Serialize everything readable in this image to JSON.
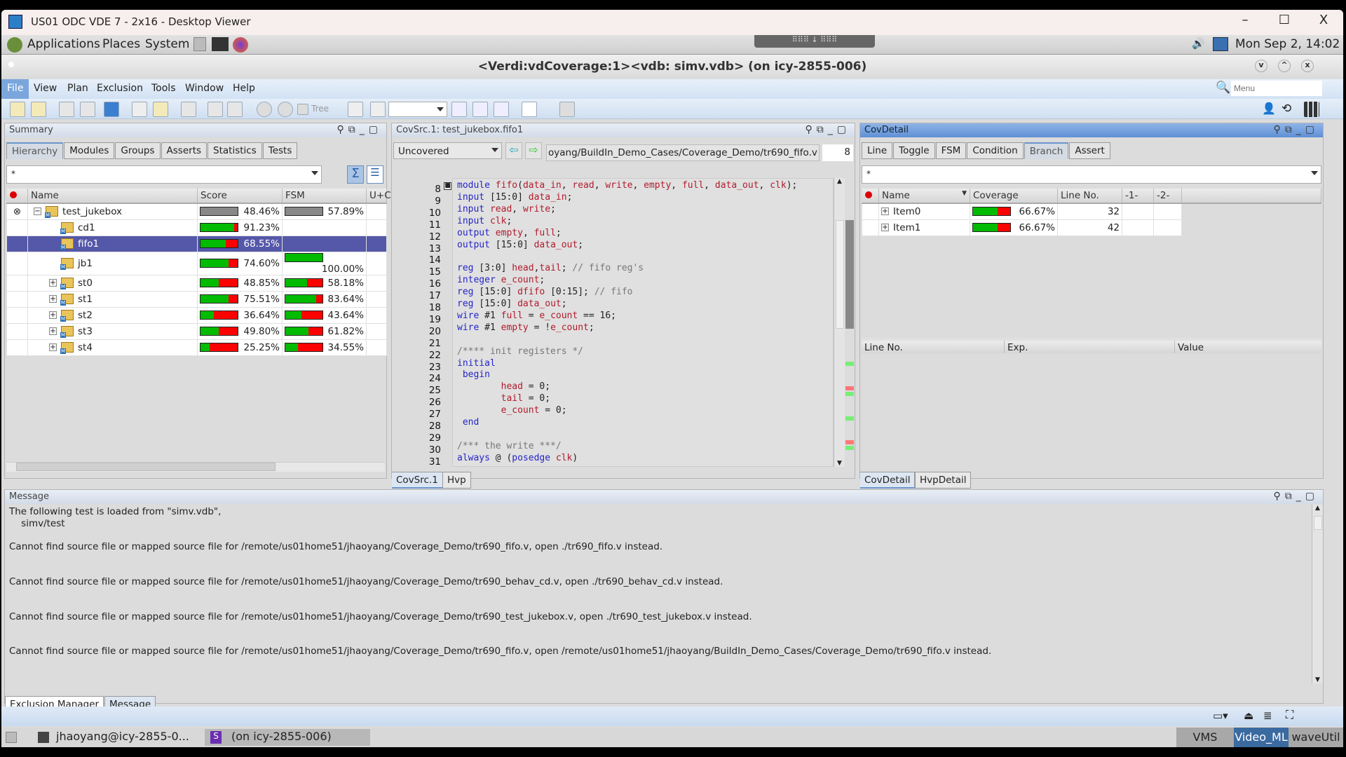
{
  "viewer": {
    "title": "US01 ODC VDE 7 - 2x16 - Desktop Viewer",
    "minimize": "–",
    "maximize": "☐",
    "close": "X"
  },
  "gnome": {
    "applications": "Applications",
    "places": "Places",
    "system": "System",
    "clock": "Mon Sep  2, 14:02"
  },
  "app": {
    "title": "<Verdi:vdCoverage:1><vdb: simv.vdb> (on icy-2855-006)"
  },
  "menu": {
    "items": [
      "File",
      "View",
      "Plan",
      "Exclusion",
      "Tools",
      "Window",
      "Help"
    ],
    "search_placeholder": "Menu",
    "tree_label": "Tree"
  },
  "summary": {
    "title": "Summary",
    "tabs": [
      "Hierarchy",
      "Modules",
      "Groups",
      "Asserts",
      "Statistics",
      "Tests"
    ],
    "filter": "*",
    "columns": [
      "Name",
      "Score",
      "FSM",
      "U+C"
    ],
    "rows": [
      {
        "name": "test_jukebox",
        "score": "48.46%",
        "fsm": "57.89%",
        "level": 0,
        "expander": "−",
        "gray": true
      },
      {
        "name": "cd1",
        "score": "91.23%",
        "fsm": "",
        "level": 1,
        "expander": ""
      },
      {
        "name": "fifo1",
        "score": "68.55%",
        "fsm": "",
        "level": 1,
        "expander": "",
        "selected": true
      },
      {
        "name": "jb1",
        "score": "74.60%",
        "fsm": "100.00%",
        "level": 1,
        "expander": ""
      },
      {
        "name": "st0",
        "score": "48.85%",
        "fsm": "58.18%",
        "level": 1,
        "expander": "+"
      },
      {
        "name": "st1",
        "score": "75.51%",
        "fsm": "83.64%",
        "level": 1,
        "expander": "+"
      },
      {
        "name": "st2",
        "score": "36.64%",
        "fsm": "43.64%",
        "level": 1,
        "expander": "+"
      },
      {
        "name": "st3",
        "score": "49.80%",
        "fsm": "61.82%",
        "level": 1,
        "expander": "+"
      },
      {
        "name": "st4",
        "score": "25.25%",
        "fsm": "34.55%",
        "level": 1,
        "expander": "+"
      }
    ]
  },
  "covsrc": {
    "title": "CovSrc.1: test_jukebox.fifo1",
    "mode": "Uncovered",
    "path": "oyang/BuildIn_Demo_Cases/Coverage_Demo/tr690_fifo.v",
    "line_input": "8",
    "first_line": 8,
    "lines": [
      [
        [
          "kw",
          "module"
        ],
        [
          "pn",
          " "
        ],
        [
          "id",
          "fifo"
        ],
        [
          "pn",
          "("
        ],
        [
          "id",
          "data_in"
        ],
        [
          "pn",
          ", "
        ],
        [
          "id",
          "read"
        ],
        [
          "pn",
          ", "
        ],
        [
          "id",
          "write"
        ],
        [
          "pn",
          ", "
        ],
        [
          "id",
          "empty"
        ],
        [
          "pn",
          ", "
        ],
        [
          "id",
          "full"
        ],
        [
          "pn",
          ", "
        ],
        [
          "id",
          "data_out"
        ],
        [
          "pn",
          ", "
        ],
        [
          "id",
          "clk"
        ],
        [
          "pn",
          ");"
        ]
      ],
      [
        [
          "kw",
          "input"
        ],
        [
          "pn",
          " [15:0] "
        ],
        [
          "id",
          "data_in"
        ],
        [
          "pn",
          ";"
        ]
      ],
      [
        [
          "kw",
          "input"
        ],
        [
          "pn",
          " "
        ],
        [
          "id",
          "read"
        ],
        [
          "pn",
          ", "
        ],
        [
          "id",
          "write"
        ],
        [
          "pn",
          ";"
        ]
      ],
      [
        [
          "kw",
          "input"
        ],
        [
          "pn",
          " "
        ],
        [
          "id",
          "clk"
        ],
        [
          "pn",
          ";"
        ]
      ],
      [
        [
          "kw",
          "output"
        ],
        [
          "pn",
          " "
        ],
        [
          "id",
          "empty"
        ],
        [
          "pn",
          ", "
        ],
        [
          "id",
          "full"
        ],
        [
          "pn",
          ";"
        ]
      ],
      [
        [
          "kw",
          "output"
        ],
        [
          "pn",
          " [15:0] "
        ],
        [
          "id",
          "data_out"
        ],
        [
          "pn",
          ";"
        ]
      ],
      [],
      [
        [
          "kw",
          "reg"
        ],
        [
          "pn",
          " [3:0] "
        ],
        [
          "id",
          "head"
        ],
        [
          "pn",
          ","
        ],
        [
          "id",
          "tail"
        ],
        [
          "pn",
          "; "
        ],
        [
          "cm",
          "// fifo reg's"
        ]
      ],
      [
        [
          "kw",
          "integer"
        ],
        [
          "pn",
          " "
        ],
        [
          "id",
          "e_count"
        ],
        [
          "pn",
          ";"
        ]
      ],
      [
        [
          "kw",
          "reg"
        ],
        [
          "pn",
          " [15:0] "
        ],
        [
          "id",
          "dfifo"
        ],
        [
          "pn",
          " [0:15]; "
        ],
        [
          "cm",
          "// fifo"
        ]
      ],
      [
        [
          "kw",
          "reg"
        ],
        [
          "pn",
          " [15:0] "
        ],
        [
          "id",
          "data_out"
        ],
        [
          "pn",
          ";"
        ]
      ],
      [
        [
          "kw",
          "wire"
        ],
        [
          "pn",
          " #1 "
        ],
        [
          "id",
          "full"
        ],
        [
          "pn",
          " = "
        ],
        [
          "id",
          "e_count"
        ],
        [
          "pn",
          " == 16;"
        ]
      ],
      [
        [
          "kw",
          "wire"
        ],
        [
          "pn",
          " #1 "
        ],
        [
          "id",
          "empty"
        ],
        [
          "pn",
          " = !"
        ],
        [
          "id",
          "e_count"
        ],
        [
          "pn",
          ";"
        ]
      ],
      [],
      [
        [
          "cm",
          "/**** init registers */"
        ]
      ],
      [
        [
          "kw",
          "initial"
        ]
      ],
      [
        [
          "pn",
          " "
        ],
        [
          "kw",
          "begin"
        ]
      ],
      [
        [
          "pn",
          "        "
        ],
        [
          "id",
          "head"
        ],
        [
          "pn",
          " = 0;"
        ]
      ],
      [
        [
          "pn",
          "        "
        ],
        [
          "id",
          "tail"
        ],
        [
          "pn",
          " = 0;"
        ]
      ],
      [
        [
          "pn",
          "        "
        ],
        [
          "id",
          "e_count"
        ],
        [
          "pn",
          " = 0;"
        ]
      ],
      [
        [
          "pn",
          " "
        ],
        [
          "kw",
          "end"
        ]
      ],
      [],
      [
        [
          "cm",
          "/*** the write ***/"
        ]
      ],
      [
        [
          "kw",
          "always"
        ],
        [
          "pn",
          " @ ("
        ],
        [
          "kw",
          "posedge"
        ],
        [
          "pn",
          " "
        ],
        [
          "id",
          "clk"
        ],
        [
          "pn",
          ")"
        ]
      ]
    ],
    "bottom_tabs": [
      "CovSrc.1",
      "Hvp"
    ]
  },
  "covdetail": {
    "title": "CovDetail",
    "tabs": [
      "Line",
      "Toggle",
      "FSM",
      "Condition",
      "Branch",
      "Assert"
    ],
    "active_tab": "Branch",
    "filter": "*",
    "columns": [
      "Name",
      "Coverage",
      "Line No.",
      "-1-",
      "-2-"
    ],
    "rows": [
      {
        "name": "Item0",
        "coverage": "66.67%",
        "line": "32"
      },
      {
        "name": "Item1",
        "coverage": "66.67%",
        "line": "42"
      }
    ],
    "detail_columns": [
      "Line No.",
      "Exp.",
      "Value"
    ],
    "bottom_tabs": [
      "CovDetail",
      "HvpDetail"
    ]
  },
  "message": {
    "title": "Message",
    "lines": [
      "The following test is loaded from \"simv.vdb\",",
      "    simv/test",
      "Cannot find source file or mapped source file for /remote/us01home51/jhaoyang/Coverage_Demo/tr690_fifo.v, open ./tr690_fifo.v instead.",
      "Cannot find source file or mapped source file for /remote/us01home51/jhaoyang/Coverage_Demo/tr690_behav_cd.v, open ./tr690_behav_cd.v instead.",
      "Cannot find source file or mapped source file for /remote/us01home51/jhaoyang/Coverage_Demo/tr690_test_jukebox.v, open ./tr690_test_jukebox.v instead.",
      "Cannot find source file or mapped source file for /remote/us01home51/jhaoyang/Coverage_Demo/tr690_fifo.v, open /remote/us01home51/jhaoyang/BuildIn_Demo_Cases/Coverage_Demo/tr690_fifo.v instead."
    ],
    "bottom_tabs": [
      "Exclusion Manager",
      "Message"
    ]
  },
  "taskbar": {
    "items": [
      "jhaoyang@icy-2855-0...",
      "(on icy-2855-006)"
    ],
    "workspaces": [
      "VMS",
      "Video_ML",
      "waveUtil"
    ]
  },
  "colors": {
    "covered": "#00bb00",
    "uncovered": "#ff0000",
    "selection": "#5558a8"
  }
}
